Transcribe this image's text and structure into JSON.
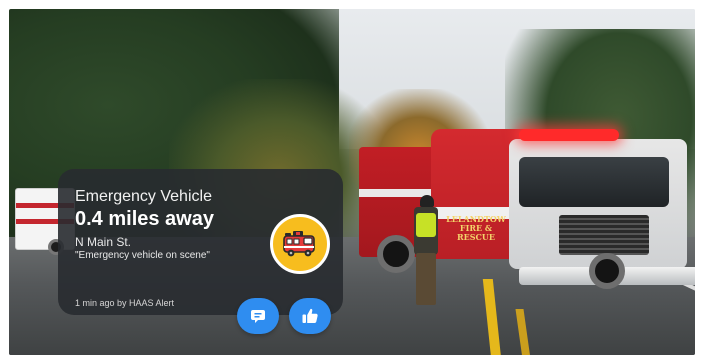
{
  "alert": {
    "title": "Emergency Vehicle",
    "distance": "0.4 miles away",
    "street": "N Main St.",
    "message": "\"Emergency vehicle on scene\"",
    "meta": "1 min ago by HAAS Alert"
  },
  "icons": {
    "badge": "fire-truck-icon",
    "comment": "comment-icon",
    "like": "thumbs-up-icon"
  },
  "truck_lettering": "LELANDTOW FIRE & RESCUE",
  "colors": {
    "card_bg": "#282b30",
    "badge_bg": "#f7bd1e",
    "button_bg": "#2f8df0"
  }
}
